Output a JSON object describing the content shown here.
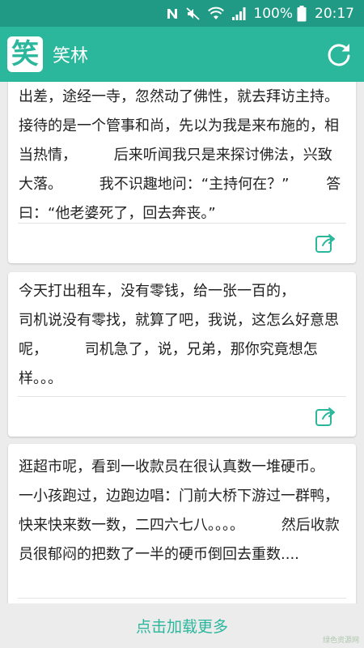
{
  "status_bar": {
    "battery": "100%",
    "time": "20:17",
    "icons": [
      "n-icon",
      "mute-icon",
      "wifi-icon",
      "signal-icon",
      "battery-icon"
    ]
  },
  "app_bar": {
    "logo_char": "笑",
    "title": "笑林",
    "refresh_icon": "refresh-icon"
  },
  "jokes": [
    {
      "text": "出差，途经一寺，忽然动了佛性，就去拜访主持。        接待的是一个管事和尚，先以为我是来布施的，相当热情，        后来听闻我只是来探讨佛法，兴致大落。        我不识趣地问：“主持何在？”        答曰：“他老婆死了，回去奔丧。”"
    },
    {
      "text": "今天打出租车，没有零钱，给一张一百的，\n司机说没有零找，就算了吧，我说，这怎么好意思呢，        司机急了，说，兄弟，那你究竟想怎样。。。"
    },
    {
      "text": "逛超市呢，看到一收款员在很认真数一堆硬币。        一小孩跑过，边跑边唱：门前大桥下游过一群鸭，        快来快来数一数，二四六七八。。。。        然后收款员很郁闷的把数了一半的硬币倒回去重数...."
    }
  ],
  "load_more": "点击加载更多",
  "watermark": "绿色资源网",
  "colors": {
    "primary": "#2bb79c",
    "status_bar": "#219a85",
    "background": "#ececec"
  }
}
